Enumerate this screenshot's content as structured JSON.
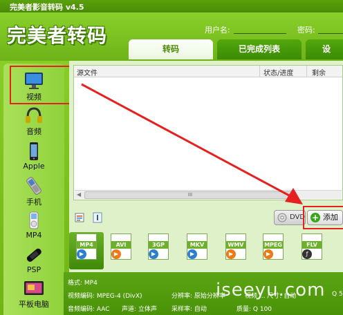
{
  "window": {
    "title": "完美者影音转码 v4.5"
  },
  "header": {
    "logo": "完美者转码",
    "username_label": "用户名:",
    "password_label": "密码:"
  },
  "tabs": [
    {
      "label": "转码"
    },
    {
      "label": "已完成列表"
    },
    {
      "label": "设"
    }
  ],
  "sidebar": {
    "items": [
      {
        "label": "视频",
        "icon": "monitor-icon"
      },
      {
        "label": "音频",
        "icon": "headphones-icon"
      },
      {
        "label": "Apple",
        "icon": "iphone-icon"
      },
      {
        "label": "手机",
        "icon": "phone-icon"
      },
      {
        "label": "MP4",
        "icon": "mp4-player-icon"
      },
      {
        "label": "PSP",
        "icon": "psp-icon"
      },
      {
        "label": "平板电脑",
        "icon": "tablet-icon"
      }
    ]
  },
  "file_list": {
    "columns": [
      "源文件",
      "状态/进度",
      "剩余"
    ],
    "scroll_grip": "III"
  },
  "toolbar": {
    "dvd_label": "DVD",
    "add_label": "添加",
    "add_glyph": "+"
  },
  "formats": [
    "MP4",
    "AVI",
    "3GP",
    "MKV",
    "WMV",
    "MPEG",
    "FLV"
  ],
  "info": {
    "format": "格式: MP4",
    "video_codec": "视频编码: MPEG-4 (DivX)",
    "resolution": "分辨率: 原始分辨率",
    "video_right": "视频 ... 尺寸: 自动",
    "audio_codec": "音频编码: AAC",
    "channels": "声道: 立体声",
    "sample_rate": "采样率: 自动",
    "quality": "质量: Q 100",
    "quality_right": "Q 5"
  },
  "watermark": "iseeyu.com",
  "colors": {
    "accent_green": "#6fb414",
    "highlight_red": "#e62020"
  }
}
